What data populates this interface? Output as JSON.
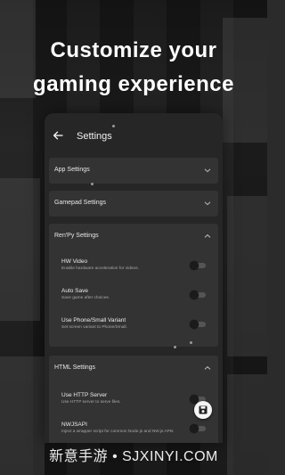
{
  "headline": {
    "line1": "Customize your",
    "line2": "gaming experience"
  },
  "app": {
    "title": "Settings",
    "sections": [
      {
        "title": "App Settings",
        "expanded": false
      },
      {
        "title": "Gamepad Settings",
        "expanded": false
      },
      {
        "title": "Ren'Py Settings",
        "expanded": true,
        "items": [
          {
            "title": "HW Video",
            "desc": "Enable hardware acceleration for videos."
          },
          {
            "title": "Auto Save",
            "desc": "Save game after choices."
          },
          {
            "title": "Use Phone/Small Variant",
            "desc": "Set screen variant to Phone/Small."
          }
        ]
      },
      {
        "title": "HTML Settings",
        "expanded": true,
        "items": [
          {
            "title": "Use HTTP Server",
            "desc": "Use HTTP server to serve files."
          },
          {
            "title": "NWJSAPI",
            "desc": "Inject a wrapper script for common Node.js and NW.js APIs"
          }
        ]
      }
    ]
  },
  "watermark": "新意手游 • SJXINYI.COM",
  "icons": {
    "back": "arrow-left-icon",
    "collapsed": "chevron-down-icon",
    "expanded": "chevron-up-icon",
    "fab": "save-icon"
  },
  "colors": {
    "panel": "#262626",
    "section": "#333333",
    "text": "#ececec"
  }
}
